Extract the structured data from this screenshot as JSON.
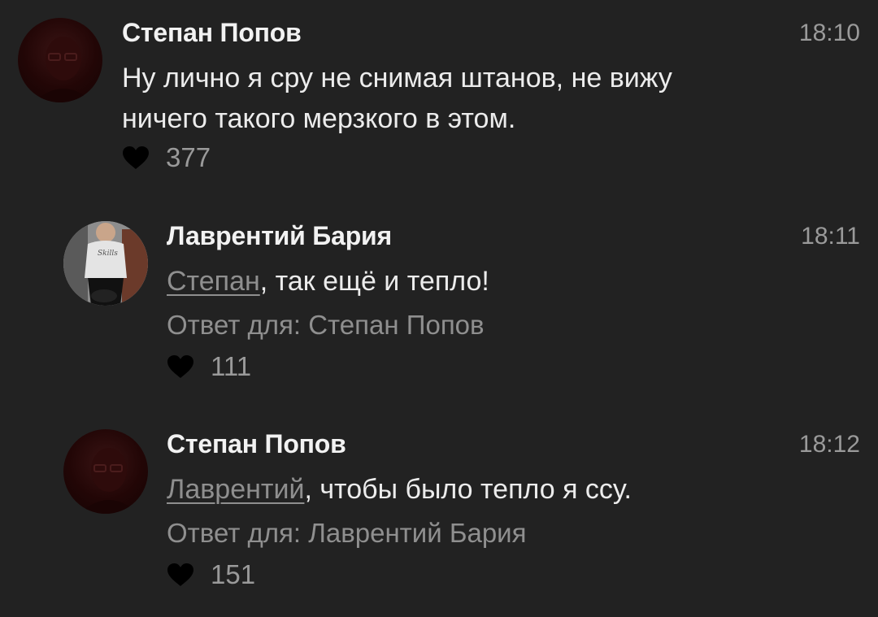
{
  "comments": [
    {
      "author": "Степан Попов",
      "time": "18:10",
      "lines": [
        "Ну лично я сру не снимая штанов, не вижу",
        "ничего такого мерзкого в этом."
      ],
      "likes": "377",
      "avatar_icon": "user-photo-dark-red"
    },
    {
      "author": "Лаврентий Бария",
      "time": "18:11",
      "mention": "Степан",
      "text": ", так ещё и тепло!",
      "reply_to": "Ответ для: Степан Попов",
      "likes": "111",
      "avatar_icon": "user-photo-outdoor"
    },
    {
      "author": "Степан Попов",
      "time": "18:12",
      "mention": "Лаврентий",
      "text": ", чтобы было тепло я ссу.",
      "reply_to": "Ответ для: Лаврентий Бария",
      "likes": "151",
      "avatar_icon": "user-photo-dark-red"
    }
  ],
  "colors": {
    "background": "#222222",
    "text": "#ececec",
    "muted": "#8f8f8f",
    "heart": "#000000"
  }
}
